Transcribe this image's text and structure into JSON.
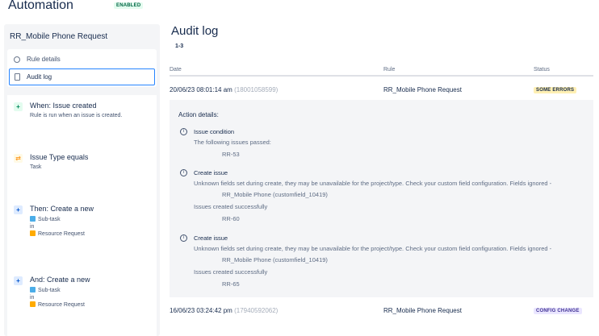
{
  "header": {
    "title": "Automation",
    "status_badge": "ENABLED"
  },
  "sidebar": {
    "rule_name": "RR_Mobile Phone Request",
    "menu": [
      {
        "label": "Rule details",
        "icon": "gear-icon"
      },
      {
        "label": "Audit log",
        "icon": "document-icon"
      }
    ],
    "rule_steps": [
      {
        "title": "When: Issue created",
        "subtitle": "Rule is run when an issue is created.",
        "kind": "trigger"
      },
      {
        "title": "Issue Type equals",
        "subtitle": "Task",
        "kind": "condition"
      },
      {
        "title": "Then: Create a new",
        "item1": "Sub-task",
        "connector": "in",
        "item2": "Resource Request",
        "kind": "action"
      },
      {
        "title": "And: Create a new",
        "item1": "Sub-task",
        "connector": "in",
        "item2": "Resource Request",
        "kind": "action"
      }
    ]
  },
  "main": {
    "title": "Audit log",
    "count": "1-3",
    "columns": {
      "date": "Date",
      "rule": "Rule",
      "status": "Status"
    },
    "rows": [
      {
        "date": "20/06/23 08:01:14 am",
        "id": "(18001058599)",
        "rule": "RR_Mobile Phone Request",
        "status": "SOME ERRORS"
      },
      {
        "date": "16/06/23 03:24:42 pm",
        "id": "(17940592062)",
        "rule": "RR_Mobile Phone Request",
        "status": "CONFIG CHANGE"
      }
    ],
    "details": {
      "title": "Action details:",
      "blocks": [
        {
          "name": "Issue condition",
          "line1": "The following issues passed:",
          "value1": "RR-53"
        },
        {
          "name": "Create issue",
          "line1": "Unknown fields set during create, they may be unavailable for the project/type. Check your custom field configuration. Fields ignored -",
          "value1": "RR_Mobile Phone (customfield_10419)",
          "line2": "Issues created successfully",
          "value2": "RR-60"
        },
        {
          "name": "Create issue",
          "line1": "Unknown fields set during create, they may be unavailable for the project/type. Check your custom field configuration. Fields ignored -",
          "value1": "RR_Mobile Phone (customfield_10419)",
          "line2": "Issues created successfully",
          "value2": "RR-65"
        }
      ]
    }
  },
  "colors": {
    "accent": "#2684ff",
    "some_errors": "#fff0b3",
    "config_change": "#eae6ff",
    "enabled": "#e3fcef"
  }
}
